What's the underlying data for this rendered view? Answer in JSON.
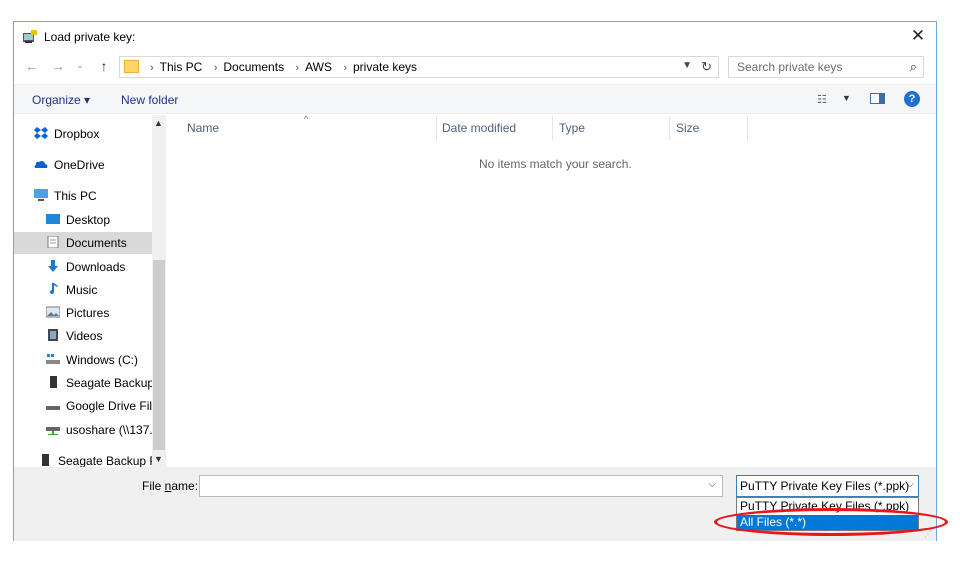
{
  "window": {
    "title": "Load private key:",
    "close": "✕"
  },
  "nav": {
    "back": "←",
    "forward": "→",
    "recent": "⌄",
    "up": "↑",
    "breadcrumbs": [
      "This PC",
      "Documents",
      "AWS",
      "private keys"
    ],
    "search_placeholder": "Search private keys"
  },
  "toolbar": {
    "organize": "Organize ▾",
    "new_folder": "New folder"
  },
  "sidebar": {
    "items": [
      {
        "label": "Dropbox",
        "icon": "dropbox-icon"
      },
      {
        "label": "OneDrive",
        "icon": "onedrive-icon"
      },
      {
        "label": "This PC",
        "icon": "pc-icon"
      },
      {
        "label": "Desktop",
        "icon": "desktop-icon"
      },
      {
        "label": "Documents",
        "icon": "documents-icon",
        "selected": true
      },
      {
        "label": "Downloads",
        "icon": "downloads-icon"
      },
      {
        "label": "Music",
        "icon": "music-icon"
      },
      {
        "label": "Pictures",
        "icon": "pictures-icon"
      },
      {
        "label": "Videos",
        "icon": "videos-icon"
      },
      {
        "label": "Windows (C:)",
        "icon": "drive-icon"
      },
      {
        "label": "Seagate Backup",
        "icon": "drive-icon"
      },
      {
        "label": "Google Drive File",
        "icon": "drive-icon"
      },
      {
        "label": "usoshare (\\\\137.",
        "icon": "network-drive-icon"
      },
      {
        "label": "Seagate Backup P",
        "icon": "drive-icon"
      }
    ]
  },
  "columns": {
    "name": "Name",
    "date_modified": "Date modified",
    "type": "Type",
    "size": "Size"
  },
  "empty_message": "No items match your search.",
  "bottom": {
    "file_name_label_pre": "File ",
    "file_name_label_u": "n",
    "file_name_label_post": "ame:",
    "file_name_value": "",
    "file_type_selected": "PuTTY Private Key Files (*.ppk)",
    "file_type_options": [
      "PuTTY Private Key Files (*.ppk)",
      "All Files (*.*)"
    ]
  },
  "colors": {
    "highlight": "#0078d7",
    "annotation": "#e8151b"
  }
}
